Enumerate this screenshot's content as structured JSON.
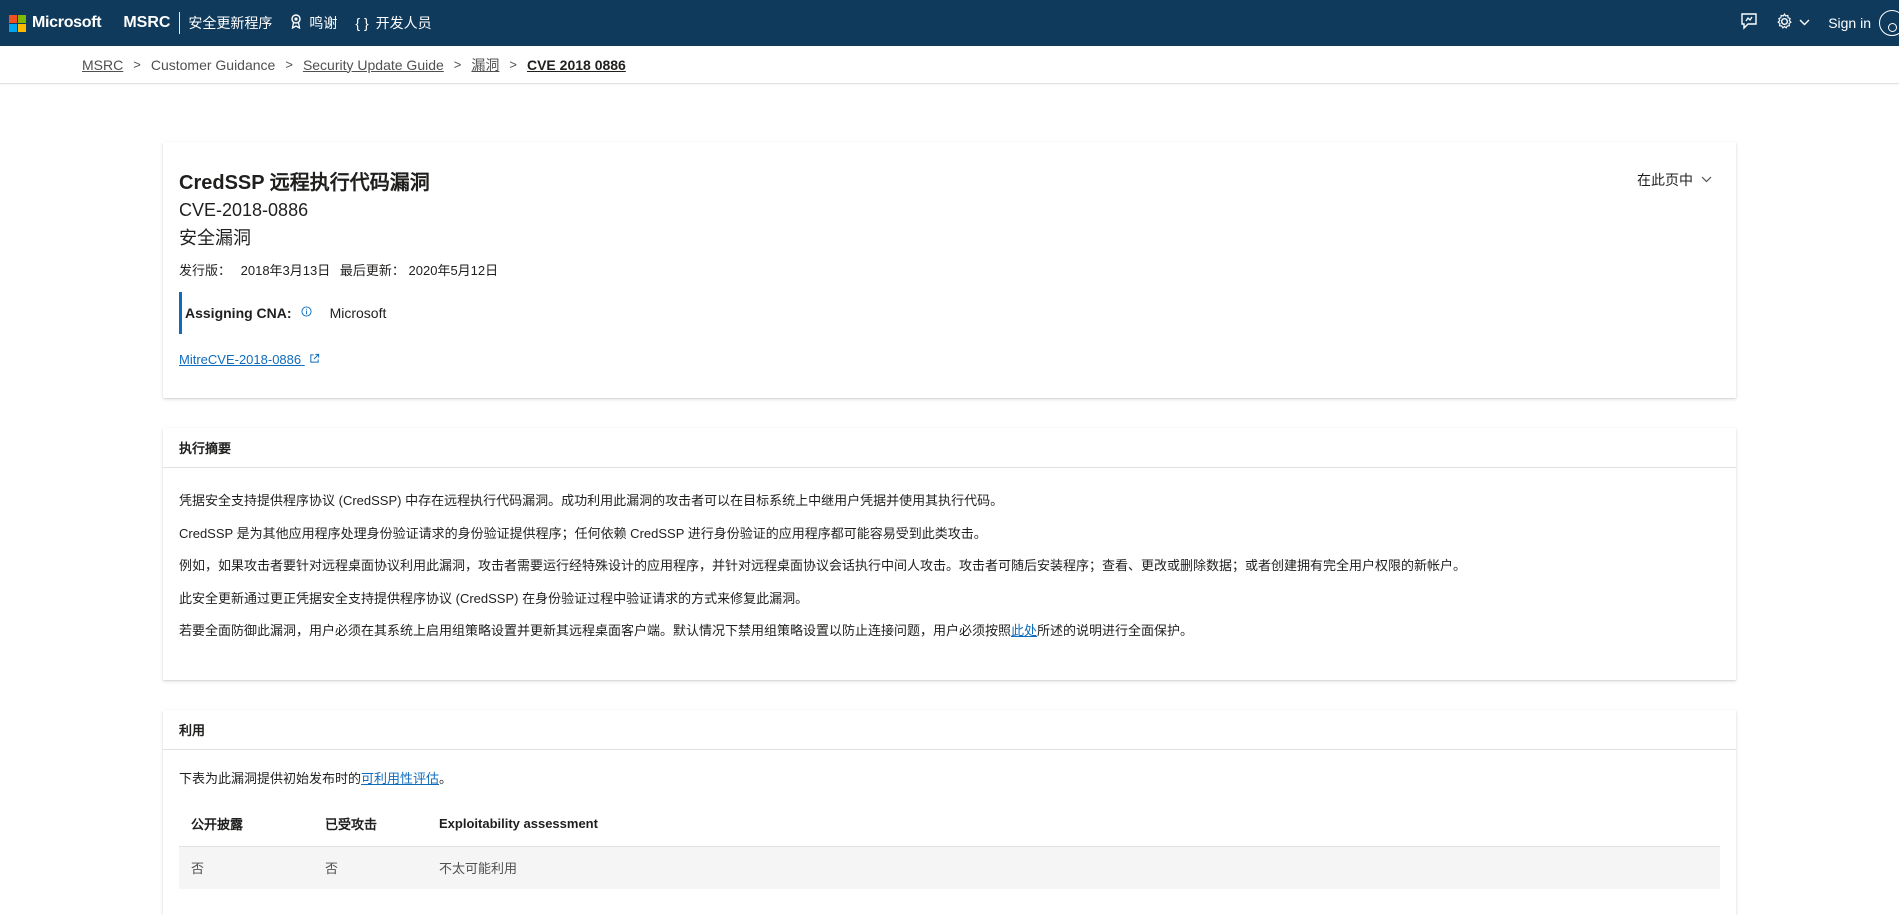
{
  "topnav": {
    "brand": "Microsoft",
    "product": "MSRC",
    "links": [
      {
        "label": "安全更新程序",
        "icon": ""
      },
      {
        "label": "鸣谢",
        "icon": "award-icon"
      },
      {
        "label": "开发人员",
        "icon": "code-braces-icon"
      }
    ],
    "feedback_icon": "feedback-icon",
    "settings_icon": "gear-icon",
    "signin_label": "Sign in",
    "colors": {
      "bar": "#0f3a5c",
      "logo": [
        "#f25022",
        "#7fba00",
        "#00a4ef",
        "#ffb900"
      ]
    }
  },
  "breadcrumb": [
    {
      "label": "MSRC",
      "link": true
    },
    {
      "label": "Customer Guidance",
      "link": false
    },
    {
      "label": "Security Update Guide",
      "link": true
    },
    {
      "label": "漏洞",
      "link": true
    },
    {
      "label": "CVE 2018 0886",
      "link": false,
      "current": true
    }
  ],
  "header": {
    "title": "CredSSP 远程执行代码漏洞",
    "cve_id": "CVE-2018-0886",
    "type": "安全漏洞",
    "released_label": "发行版：",
    "released_date": "2018年3月13日",
    "updated_label": "最后更新：",
    "updated_date": "2020年5月12日",
    "cna_label": "Assigning CNA:",
    "cna_value": "Microsoft",
    "mitre_link": "MitreCVE-2018-0886",
    "on_page_label": "在此页中"
  },
  "summary": {
    "heading": "执行摘要",
    "paragraphs": [
      "凭据安全支持提供程序协议 (CredSSP) 中存在远程执行代码漏洞。成功利用此漏洞的攻击者可以在目标系统上中继用户凭据并使用其执行代码。",
      "CredSSP 是为其他应用程序处理身份验证请求的身份验证提供程序；任何依赖 CredSSP 进行身份验证的应用程序都可能容易受到此类攻击。",
      "例如，如果攻击者要针对远程桌面协议利用此漏洞，攻击者需要运行经特殊设计的应用程序，并针对远程桌面协议会话执行中间人攻击。攻击者可随后安装程序；查看、更改或删除数据；或者创建拥有完全用户权限的新帐户。",
      "此安全更新通过更正凭据安全支持提供程序协议 (CredSSP) 在身份验证过程中验证请求的方式来修复此漏洞。"
    ],
    "last_before": "若要全面防御此漏洞，用户必须在其系统上启用组策略设置并更新其远程桌面客户端。默认情况下禁用组策略设置以防止连接问题，用户必须按照",
    "last_link": "此处",
    "last_after": "所述的说明进行全面保护。"
  },
  "exploitability": {
    "heading": "利用",
    "intro_before": "下表为此漏洞提供初始发布时的",
    "intro_link": "可利用性评估",
    "intro_after": "。",
    "columns": [
      "公开披露",
      "已受攻击",
      "Exploitability assessment"
    ],
    "row": [
      "否",
      "否",
      "不太可能利用"
    ]
  }
}
